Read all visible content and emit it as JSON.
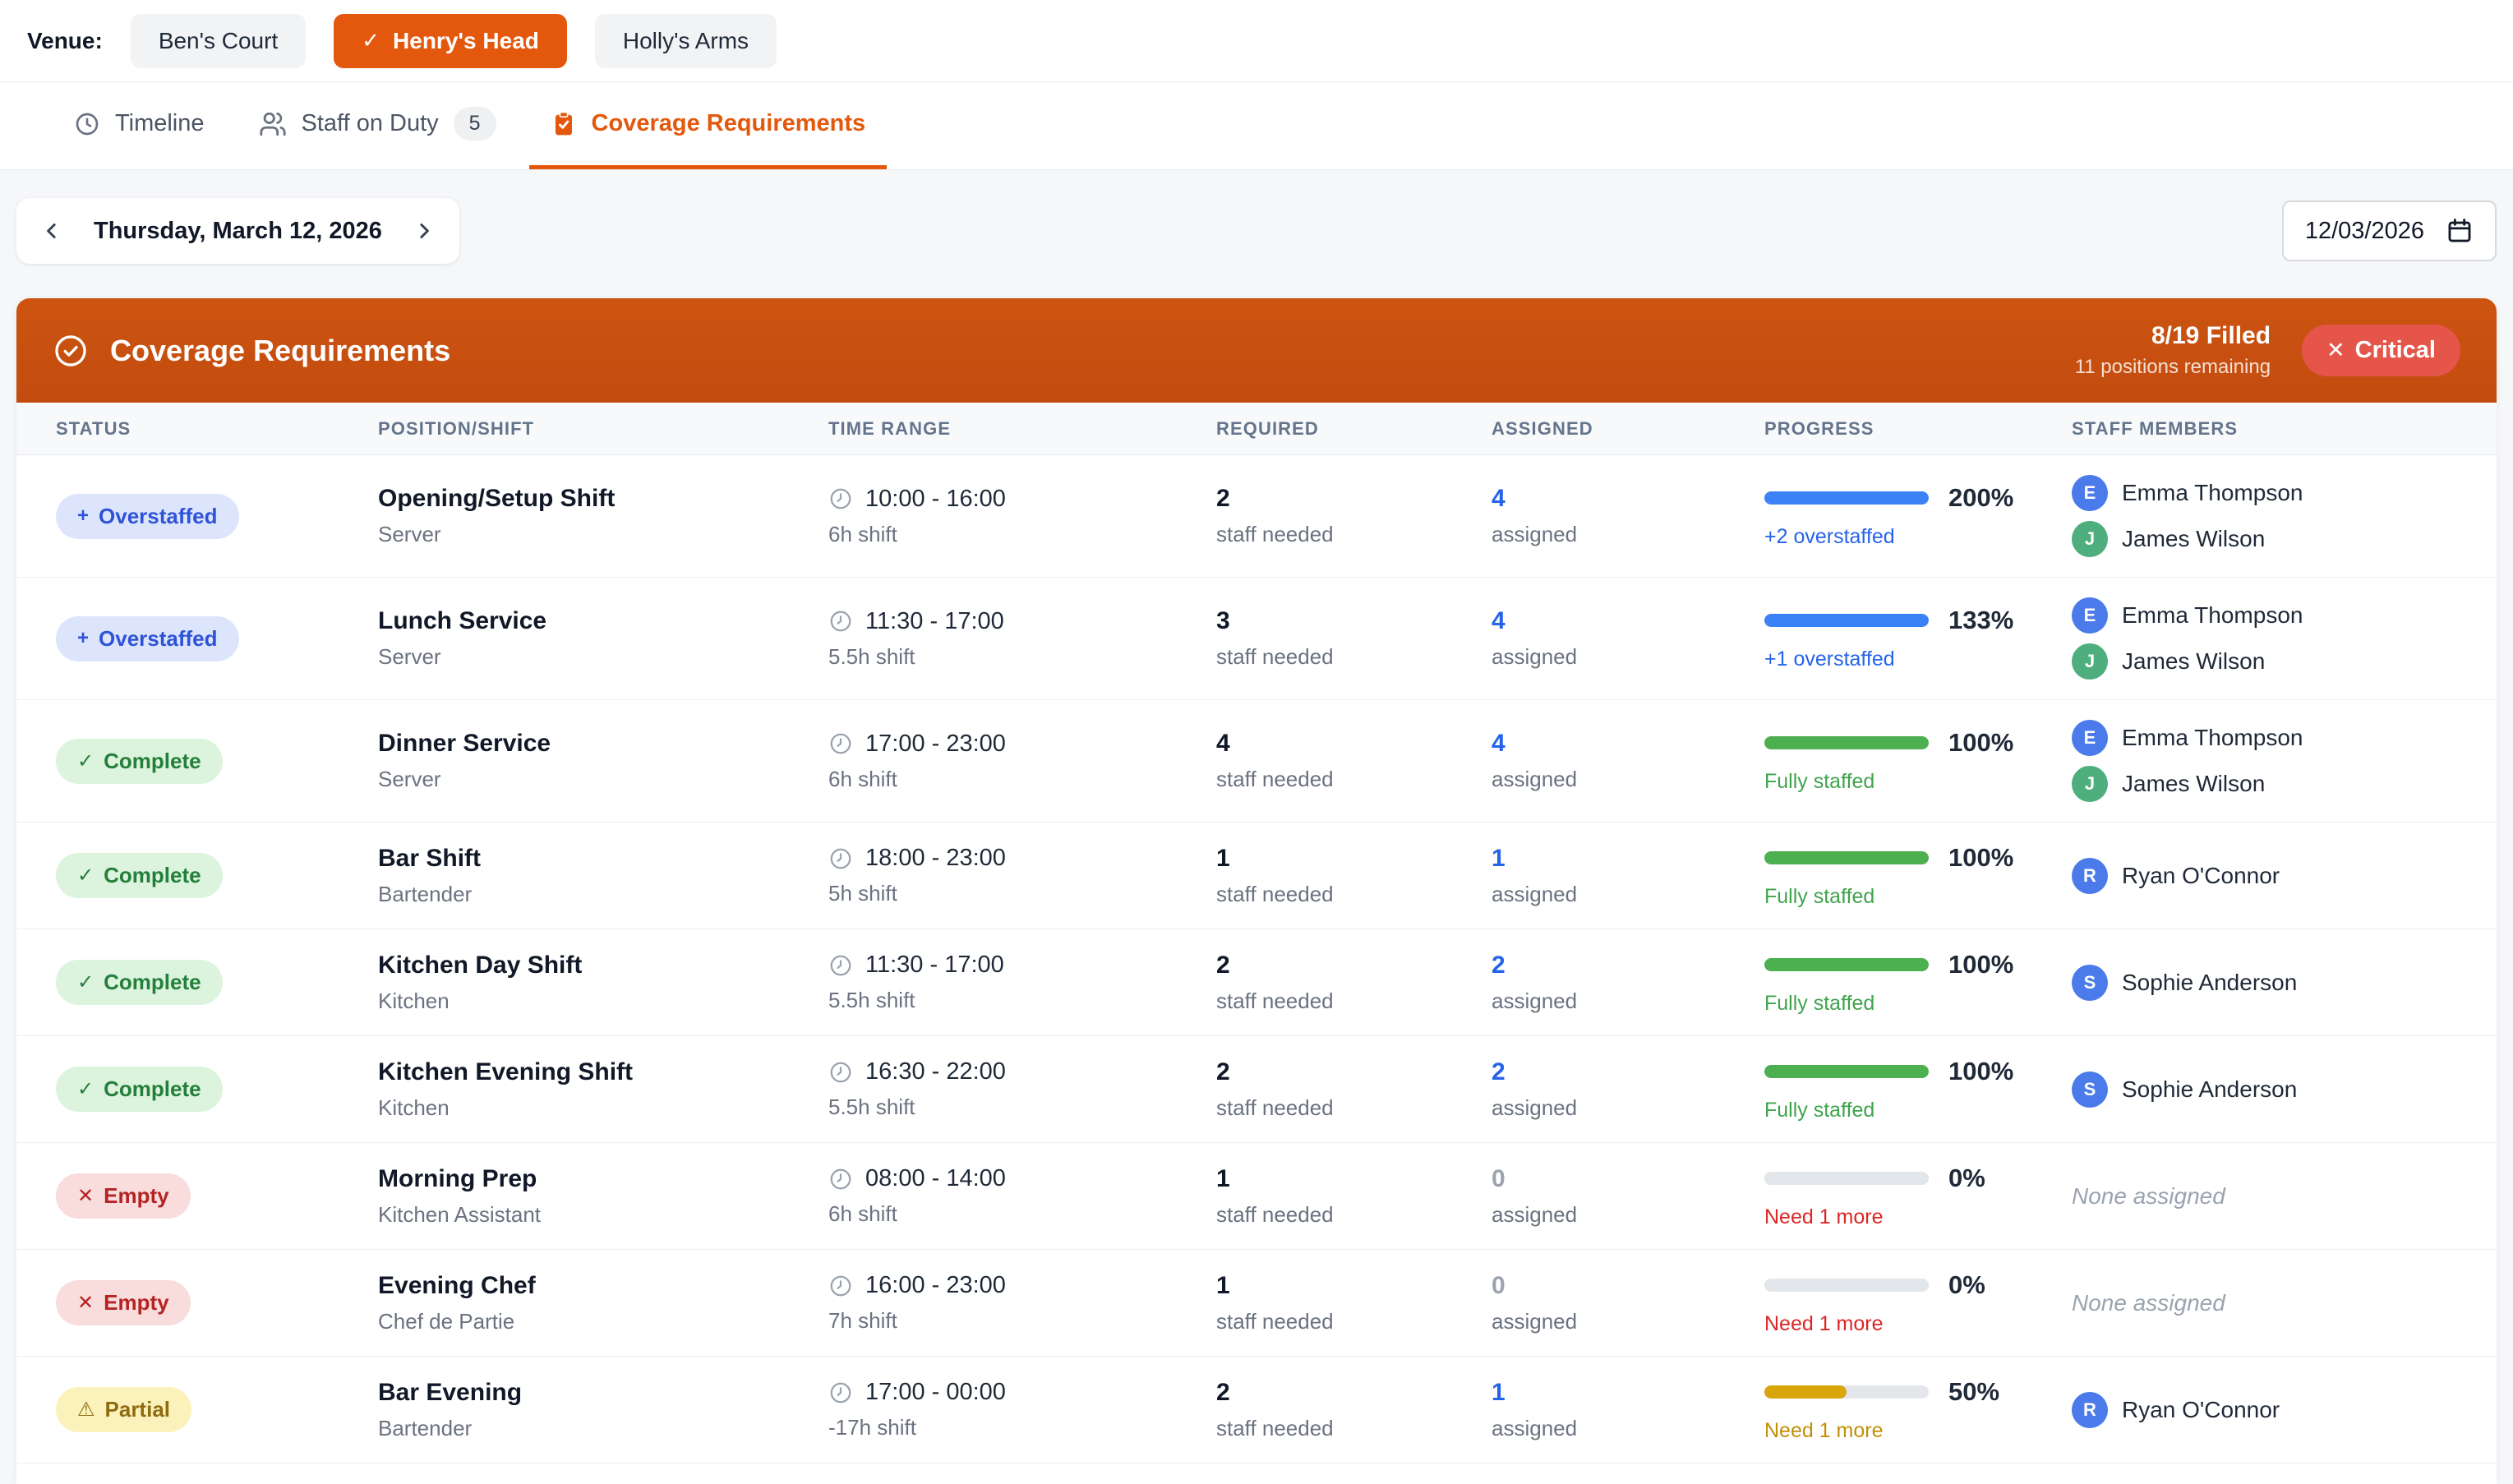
{
  "venue_bar": {
    "label": "Venue:",
    "options": [
      {
        "name": "Ben's Court",
        "selected": false
      },
      {
        "name": "Henry's Head",
        "selected": true,
        "check": "✓"
      },
      {
        "name": "Holly's Arms",
        "selected": false
      }
    ]
  },
  "tabs": [
    {
      "label": "Timeline",
      "icon": "clock-icon",
      "active": false
    },
    {
      "label": "Staff on Duty",
      "icon": "users-icon",
      "badge": "5",
      "active": false
    },
    {
      "label": "Coverage Requirements",
      "icon": "clipboard-check-icon",
      "active": true
    }
  ],
  "date_nav": {
    "label": "Thursday, March 12, 2026"
  },
  "date_input": {
    "value": "12/03/2026"
  },
  "summary": {
    "title": "Coverage Requirements",
    "filled": "8/19 Filled",
    "remaining": "11 positions remaining",
    "critical_icon": "✕",
    "critical_label": "Critical"
  },
  "table": {
    "headers": [
      "STATUS",
      "POSITION/SHIFT",
      "TIME RANGE",
      "REQUIRED",
      "ASSIGNED",
      "PROGRESS",
      "STAFF MEMBERS"
    ]
  },
  "rows": [
    {
      "status": {
        "icon": "+",
        "label": "Overstaffed",
        "variant": "overstaffed"
      },
      "position": {
        "title": "Opening/Setup Shift",
        "role": "Server"
      },
      "time": {
        "range": "10:00 - 16:00",
        "duration": "6h shift"
      },
      "required": {
        "value": "2",
        "caption": "staff needed"
      },
      "assigned": {
        "value": "4",
        "caption": "assigned"
      },
      "progress": {
        "percent_label": "200%",
        "fill_pct": 100,
        "color": "blue",
        "note": "+2 overstaffed",
        "note_color": "blue"
      },
      "staff": [
        {
          "initial": "E",
          "name": "Emma Thompson",
          "color": "blue"
        },
        {
          "initial": "J",
          "name": "James Wilson",
          "color": "green"
        }
      ]
    },
    {
      "status": {
        "icon": "+",
        "label": "Overstaffed",
        "variant": "overstaffed"
      },
      "position": {
        "title": "Lunch Service",
        "role": "Server"
      },
      "time": {
        "range": "11:30 - 17:00",
        "duration": "5.5h shift"
      },
      "required": {
        "value": "3",
        "caption": "staff needed"
      },
      "assigned": {
        "value": "4",
        "caption": "assigned"
      },
      "progress": {
        "percent_label": "133%",
        "fill_pct": 100,
        "color": "blue",
        "note": "+1 overstaffed",
        "note_color": "blue"
      },
      "staff": [
        {
          "initial": "E",
          "name": "Emma Thompson",
          "color": "blue"
        },
        {
          "initial": "J",
          "name": "James Wilson",
          "color": "green"
        }
      ]
    },
    {
      "status": {
        "icon": "✓",
        "label": "Complete",
        "variant": "complete"
      },
      "position": {
        "title": "Dinner Service",
        "role": "Server"
      },
      "time": {
        "range": "17:00 - 23:00",
        "duration": "6h shift"
      },
      "required": {
        "value": "4",
        "caption": "staff needed"
      },
      "assigned": {
        "value": "4",
        "caption": "assigned"
      },
      "progress": {
        "percent_label": "100%",
        "fill_pct": 100,
        "color": "green",
        "note": "Fully staffed",
        "note_color": "green"
      },
      "staff": [
        {
          "initial": "E",
          "name": "Emma Thompson",
          "color": "blue"
        },
        {
          "initial": "J",
          "name": "James Wilson",
          "color": "green"
        }
      ]
    },
    {
      "status": {
        "icon": "✓",
        "label": "Complete",
        "variant": "complete"
      },
      "position": {
        "title": "Bar Shift",
        "role": "Bartender"
      },
      "time": {
        "range": "18:00 - 23:00",
        "duration": "5h shift"
      },
      "required": {
        "value": "1",
        "caption": "staff needed"
      },
      "assigned": {
        "value": "1",
        "caption": "assigned"
      },
      "progress": {
        "percent_label": "100%",
        "fill_pct": 100,
        "color": "green",
        "note": "Fully staffed",
        "note_color": "green"
      },
      "staff": [
        {
          "initial": "R",
          "name": "Ryan O'Connor",
          "color": "blue"
        }
      ]
    },
    {
      "status": {
        "icon": "✓",
        "label": "Complete",
        "variant": "complete"
      },
      "position": {
        "title": "Kitchen Day Shift",
        "role": "Kitchen"
      },
      "time": {
        "range": "11:30 - 17:00",
        "duration": "5.5h shift"
      },
      "required": {
        "value": "2",
        "caption": "staff needed"
      },
      "assigned": {
        "value": "2",
        "caption": "assigned"
      },
      "progress": {
        "percent_label": "100%",
        "fill_pct": 100,
        "color": "green",
        "note": "Fully staffed",
        "note_color": "green"
      },
      "staff": [
        {
          "initial": "S",
          "name": "Sophie Anderson",
          "color": "blue"
        }
      ]
    },
    {
      "status": {
        "icon": "✓",
        "label": "Complete",
        "variant": "complete"
      },
      "position": {
        "title": "Kitchen Evening Shift",
        "role": "Kitchen"
      },
      "time": {
        "range": "16:30 - 22:00",
        "duration": "5.5h shift"
      },
      "required": {
        "value": "2",
        "caption": "staff needed"
      },
      "assigned": {
        "value": "2",
        "caption": "assigned"
      },
      "progress": {
        "percent_label": "100%",
        "fill_pct": 100,
        "color": "green",
        "note": "Fully staffed",
        "note_color": "green"
      },
      "staff": [
        {
          "initial": "S",
          "name": "Sophie Anderson",
          "color": "blue"
        }
      ]
    },
    {
      "status": {
        "icon": "✕",
        "label": "Empty",
        "variant": "empty"
      },
      "position": {
        "title": "Morning Prep",
        "role": "Kitchen Assistant"
      },
      "time": {
        "range": "08:00 - 14:00",
        "duration": "6h shift"
      },
      "required": {
        "value": "1",
        "caption": "staff needed"
      },
      "assigned": {
        "value": "0",
        "caption": "assigned"
      },
      "progress": {
        "percent_label": "0%",
        "fill_pct": 0,
        "color": "none",
        "note": "Need 1 more",
        "note_color": "red"
      },
      "staff": [],
      "staff_empty_label": "None assigned"
    },
    {
      "status": {
        "icon": "✕",
        "label": "Empty",
        "variant": "empty"
      },
      "position": {
        "title": "Evening Chef",
        "role": "Chef de Partie"
      },
      "time": {
        "range": "16:00 - 23:00",
        "duration": "7h shift"
      },
      "required": {
        "value": "1",
        "caption": "staff needed"
      },
      "assigned": {
        "value": "0",
        "caption": "assigned"
      },
      "progress": {
        "percent_label": "0%",
        "fill_pct": 0,
        "color": "none",
        "note": "Need 1 more",
        "note_color": "red"
      },
      "staff": [],
      "staff_empty_label": "None assigned"
    },
    {
      "status": {
        "icon": "⚠",
        "label": "Partial",
        "variant": "partial"
      },
      "position": {
        "title": "Bar Evening",
        "role": "Bartender"
      },
      "time": {
        "range": "17:00 - 00:00",
        "duration": "-17h shift"
      },
      "required": {
        "value": "2",
        "caption": "staff needed"
      },
      "assigned": {
        "value": "1",
        "caption": "assigned"
      },
      "progress": {
        "percent_label": "50%",
        "fill_pct": 50,
        "color": "amber",
        "note": "Need 1 more",
        "note_color": "amber"
      },
      "staff": [
        {
          "initial": "R",
          "name": "Ryan O'Connor",
          "color": "blue"
        }
      ]
    }
  ],
  "colors": {
    "accent_orange": "#E3580C",
    "banner_orange": "#C75010",
    "critical_red": "#E5554A",
    "progress_blue": "#3B82F6",
    "progress_green": "#4CAF50",
    "progress_amber": "#D9A50A",
    "progress_track": "#E3E6EA",
    "avatar_blue": "#4B7BEA",
    "avatar_green": "#4FAE7D",
    "status_colors": {
      "overstaffed": {
        "bg": "#DCE5FB",
        "text": "#2F53D8"
      },
      "complete": {
        "bg": "#DCF3DE",
        "text": "#237F39"
      },
      "empty": {
        "bg": "#F9DCDC",
        "text": "#B42323"
      },
      "partial": {
        "bg": "#FBF2BB",
        "text": "#8F6B10"
      }
    }
  }
}
